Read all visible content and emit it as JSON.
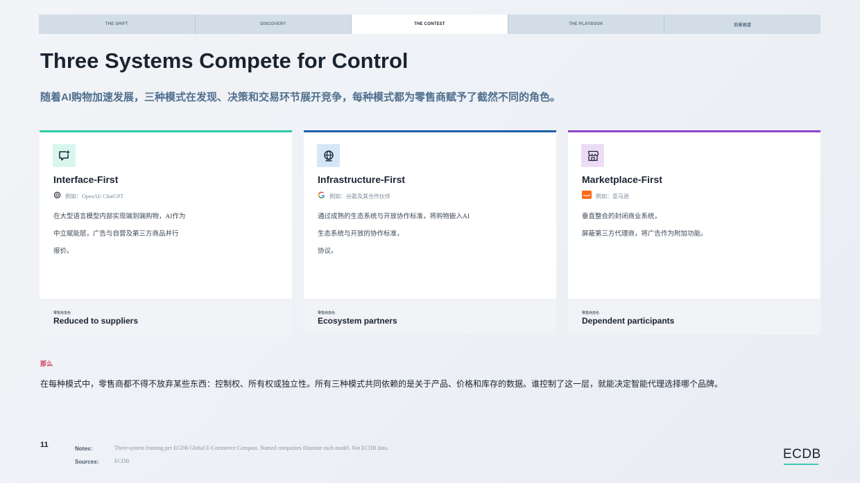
{
  "nav": {
    "tabs": [
      {
        "label": "THE SHIFT",
        "active": false
      },
      {
        "label": "DISCOVERY",
        "active": false
      },
      {
        "label": "THE CONTEST",
        "active": true
      },
      {
        "label": "THE PLAYBOOK",
        "active": false
      },
      {
        "label": "前景展望",
        "active": false
      }
    ]
  },
  "header": {
    "title": "Three Systems Compete for Control",
    "subtitle": "随着AI购物加速发展，三种模式在发现、决策和交易环节展开竞争，每种模式都为零售商赋予了截然不同的角色。"
  },
  "cards": [
    {
      "title": "Interface-First",
      "example": "例如：OpenAI/ ChatGPT",
      "icon": "chat-sparkle-icon",
      "example_icon": "openai-logo-icon",
      "accent": "#2ec9a8",
      "icon_bg": "#d7f6ee",
      "desc_lines": [
        "在大型语言模型内部实现端到端购物，AI作为",
        "中立赋能层，广告与自营及第三方商品并行",
        "报价。"
      ],
      "role_label": "零售商角色",
      "role_value": "Reduced to suppliers"
    },
    {
      "title": "Infrastructure-First",
      "example": "例如：谷歌及其合作伙伴",
      "icon": "globe-icon",
      "example_icon": "google-logo-icon",
      "accent": "#1a5fa8",
      "icon_bg": "#d5e6f7",
      "desc_lines": [
        "通过成熟的生态系统与开放协作标准，将购物嵌入AI",
        "生态系统与开放的协作标准，",
        "协议。"
      ],
      "role_label": "零售商角色",
      "role_value": "Ecosystem partners"
    },
    {
      "title": "Marketplace-First",
      "example": "例如：亚马逊",
      "icon": "storefront-icon",
      "example_icon": "amazon-logo-icon",
      "accent": "#8e44c8",
      "icon_bg": "#ecdcf6",
      "desc_lines": [
        "垂直整合的封闭商业系统，",
        "屏蔽第三方代理商，将广告作为附加功能。"
      ],
      "role_label": "零售商角色",
      "role_value": "Dependent participants"
    }
  ],
  "so_what": {
    "label": "那么",
    "text": "在每种模式中，零售商都不得不放弃某些东西：控制权、所有权或独立性。所有三种模式共同依赖的是关于产品、价格和库存的数据。谁控制了这一层，就能决定智能代理选择哪个品牌。"
  },
  "footer": {
    "page_number": "11",
    "notes_label": "Notes:",
    "notes_text": "Three-system framing per ECDB Global E-Commerce Compass. Named companies illustrate each model. Not ECDB data.",
    "sources_label": "Sources:",
    "sources_text": "ECDB",
    "logo": "ECDB"
  }
}
